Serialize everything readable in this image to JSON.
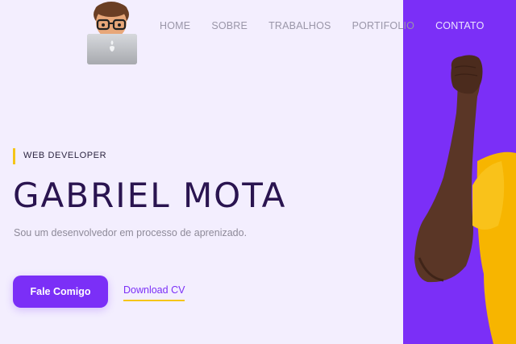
{
  "nav": {
    "items": [
      {
        "label": "HOME"
      },
      {
        "label": "SOBRE"
      },
      {
        "label": "TRABALHOS"
      },
      {
        "label": "PORTIFOLIO"
      },
      {
        "label": "CONTATO"
      }
    ]
  },
  "hero": {
    "role": "WEB DEVELOPER",
    "name": "GABRIEL MOTA",
    "description": "Sou um desenvolvedor em processo de aprenizado.",
    "contact_button": "Fale Comigo",
    "download_link": "Download CV"
  },
  "colors": {
    "background": "#f3eefe",
    "accent": "#7b2ff7",
    "highlight": "#f5c518",
    "heading": "#2a1450"
  },
  "icons": {
    "logo": "memoji-laptop-avatar-icon",
    "hero_image": "raised-fist-person-photo"
  }
}
